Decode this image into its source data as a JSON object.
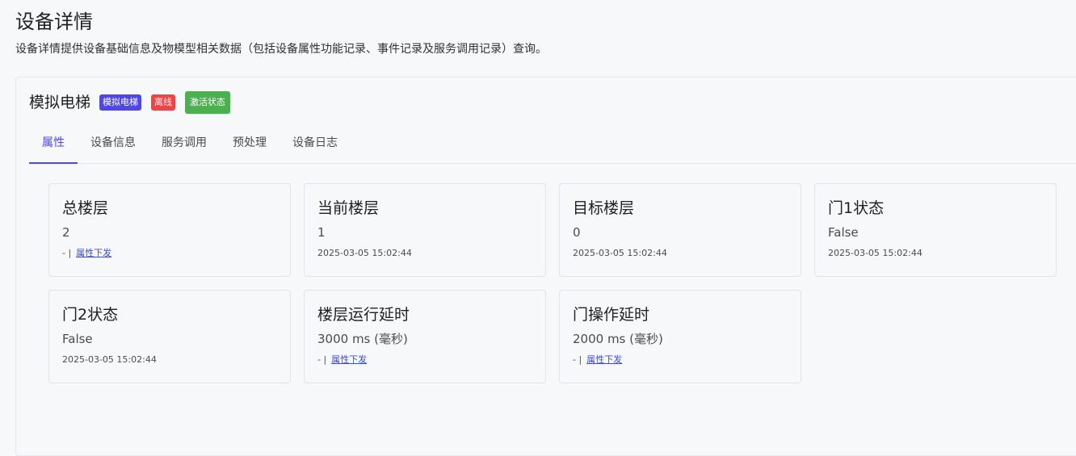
{
  "page": {
    "title": "设备详情",
    "description": "设备详情提供设备基础信息及物模型相关数据（包括设备属性功能记录、事件记录及服务调用记录）查询。"
  },
  "device": {
    "name": "模拟电梯",
    "badges": {
      "model": "模拟电梯",
      "status": "离线",
      "activation": "激活状态"
    },
    "colors": {
      "model": "#4f46e5",
      "offline": "#ef4444",
      "active": "#4caf50",
      "accent": "#4f46e5"
    }
  },
  "tabs": [
    "属性",
    "设备信息",
    "服务调用",
    "预处理",
    "设备日志"
  ],
  "active_tab": "属性",
  "properties": [
    {
      "title": "总楼层",
      "value": "2",
      "meta_prefix": "- |",
      "action": "属性下发"
    },
    {
      "title": "当前楼层",
      "value": "1",
      "timestamp": "2025-03-05 15:02:44"
    },
    {
      "title": "目标楼层",
      "value": "0",
      "timestamp": "2025-03-05 15:02:44"
    },
    {
      "title": "门1状态",
      "value": "False",
      "timestamp": "2025-03-05 15:02:44"
    },
    {
      "title": "门2状态",
      "value": "False",
      "timestamp": "2025-03-05 15:02:44"
    },
    {
      "title": "楼层运行延时",
      "value": "3000 ms (毫秒)",
      "meta_prefix": "- |",
      "action": "属性下发"
    },
    {
      "title": "门操作延时",
      "value": "2000 ms (毫秒)",
      "meta_prefix": "- |",
      "action": "属性下发"
    }
  ]
}
